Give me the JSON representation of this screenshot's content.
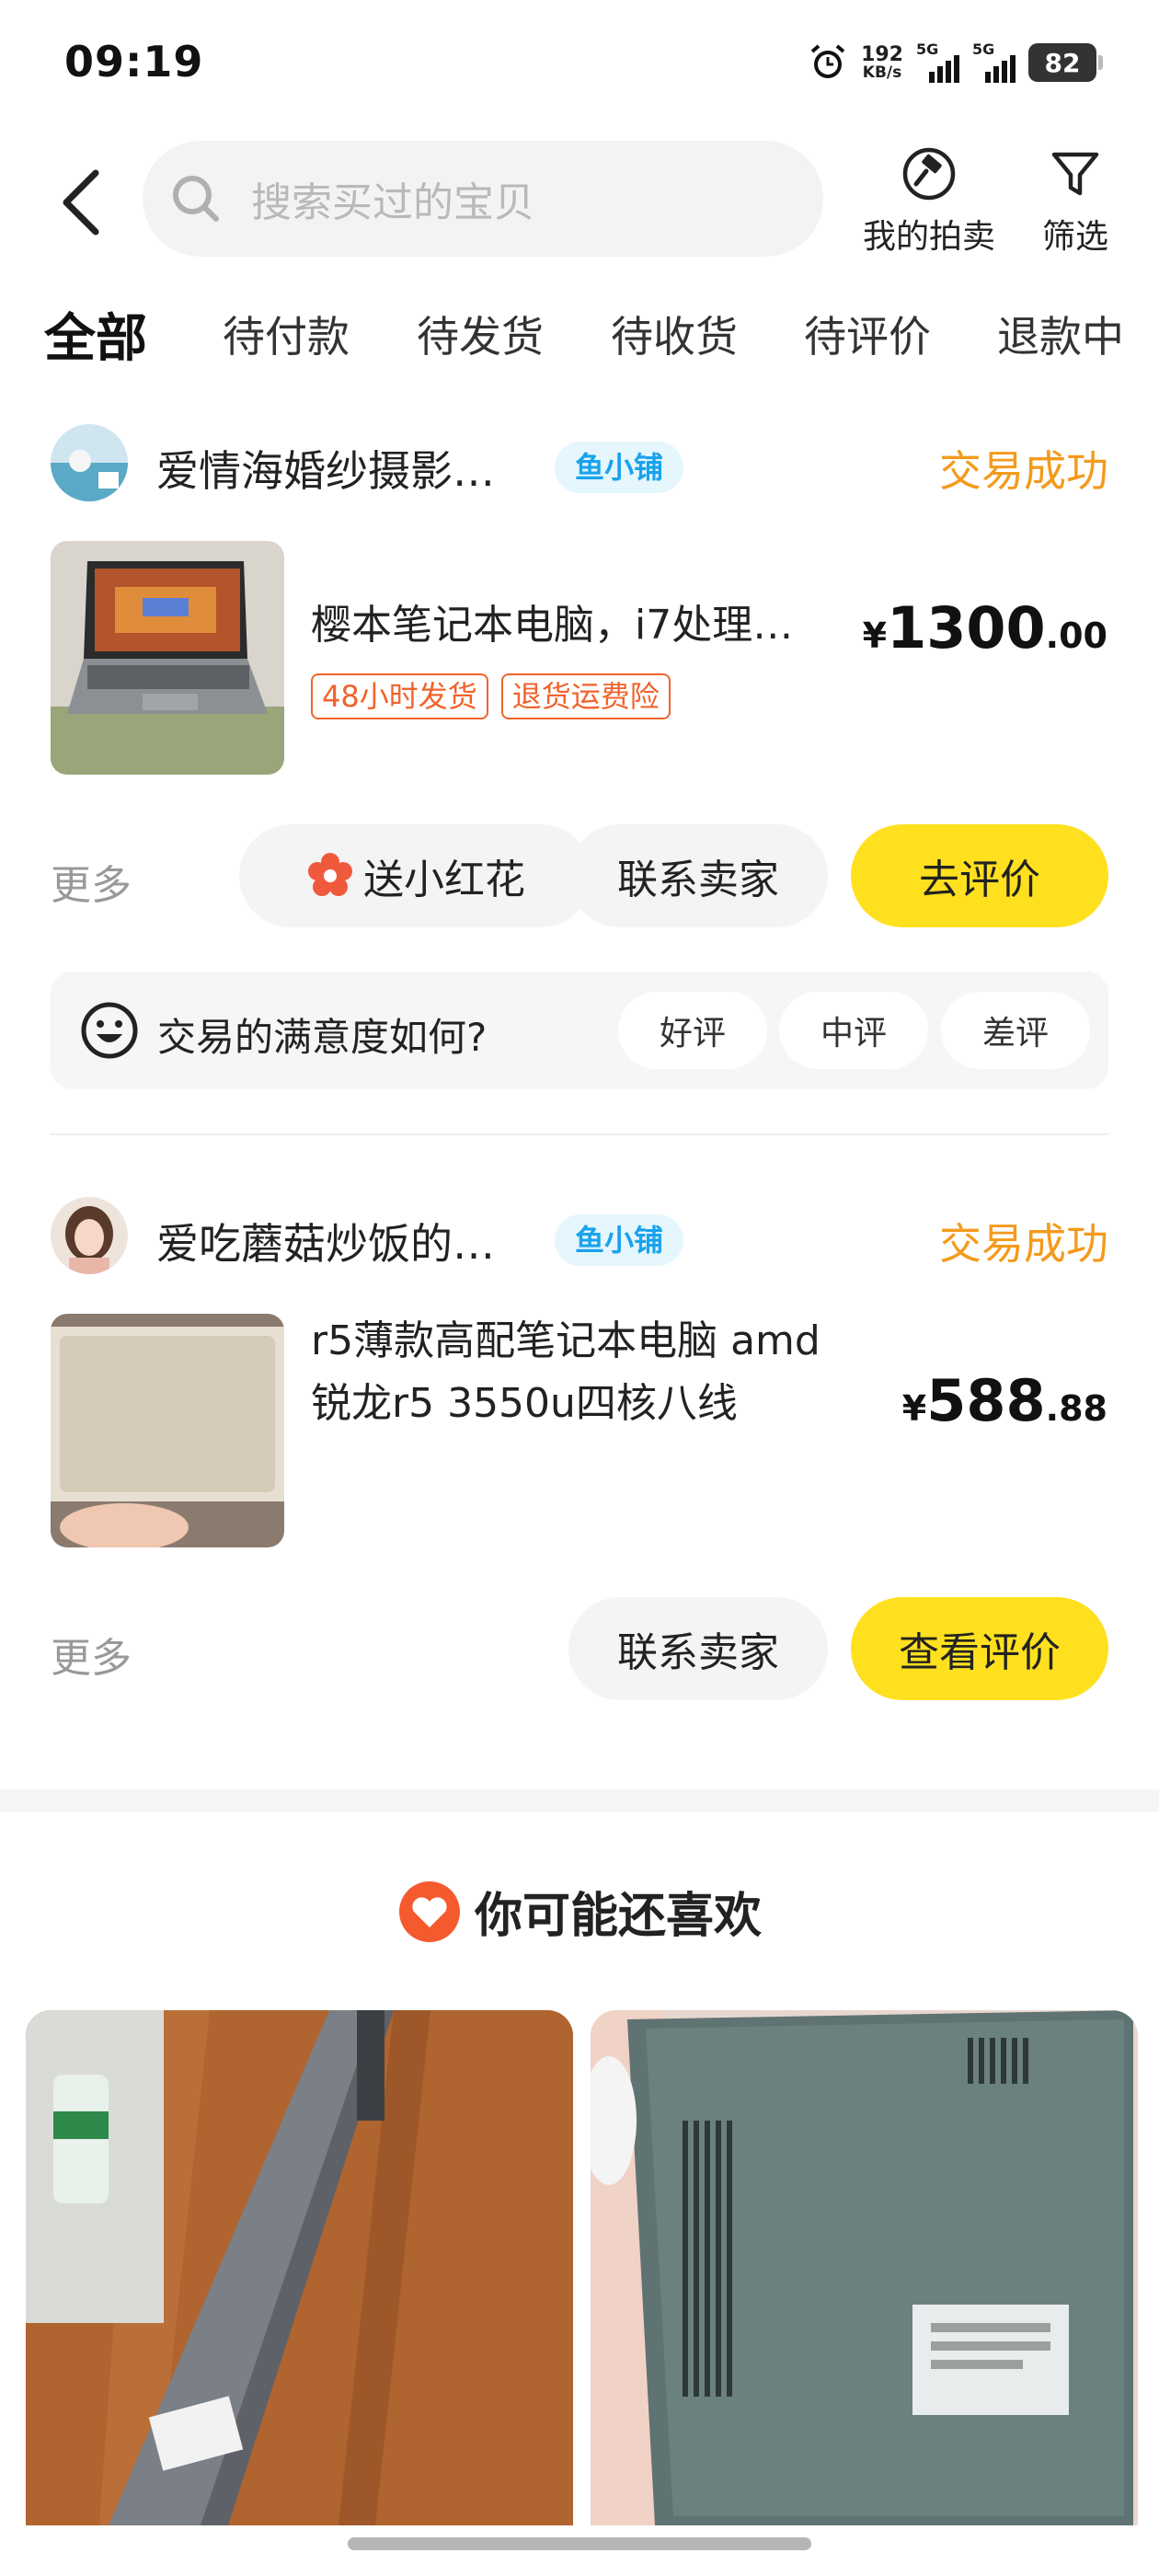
{
  "status_bar": {
    "time": "09:19",
    "net_speed_value": "192",
    "net_speed_unit": "KB/s",
    "sim1_label": "5G",
    "sim2_label": "5G",
    "battery": "82"
  },
  "header": {
    "search_placeholder": "搜索买过的宝贝",
    "my_auction_label": "我的拍卖",
    "filter_label": "筛选"
  },
  "tabs": [
    {
      "label": "全部",
      "active": true
    },
    {
      "label": "待付款"
    },
    {
      "label": "待发货"
    },
    {
      "label": "待收货"
    },
    {
      "label": "待评价"
    },
    {
      "label": "退款中"
    }
  ],
  "orders": [
    {
      "shop_name": "爱情海婚纱摄影…",
      "shop_badge": "鱼小铺",
      "status": "交易成功",
      "item_title": "樱本笔记本电脑，i7处理…",
      "price_currency": "¥",
      "price_integer": "1300",
      "price_decimal": ".00",
      "tags": [
        "48小时发货",
        "退货运费险"
      ],
      "more_label": "更多",
      "buttons": [
        "送小红花",
        "联系卖家",
        "去评价"
      ],
      "rating_question": "交易的满意度如何?",
      "rating_options": [
        "好评",
        "中评",
        "差评"
      ]
    },
    {
      "shop_name": "爱吃蘑菇炒饭的…",
      "shop_badge": "鱼小铺",
      "status": "交易成功",
      "item_title_line1": "r5薄款高配笔记本电脑 amd",
      "item_title_line2": "锐龙r5 3550u四核八线",
      "price_currency": "¥",
      "price_integer": "588",
      "price_decimal": ".88",
      "more_label": "更多",
      "buttons": [
        "联系卖家",
        "查看评价"
      ]
    }
  ],
  "recommend": {
    "title": "你可能还喜欢"
  },
  "colors": {
    "accent_yellow": "#ffe01e",
    "status_orange": "#f49a1c",
    "badge_blue": "#1aa3ec",
    "tag_red": "#f0632c"
  }
}
